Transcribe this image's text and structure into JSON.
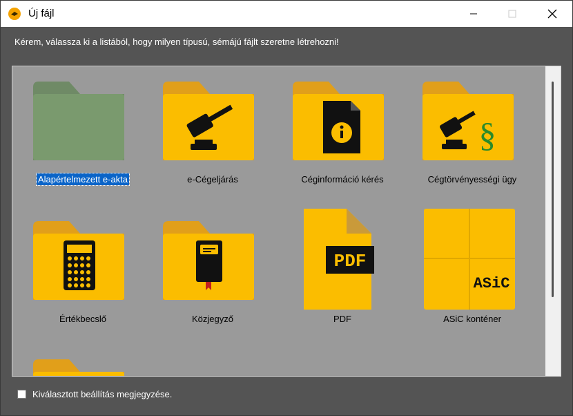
{
  "window": {
    "title": "Új fájl"
  },
  "instruction": "Kérem, válassza ki a listából, hogy milyen típusú, sémájú fájlt szeretne létrehozni!",
  "items": [
    {
      "label": "Alapértelmezett e-akta",
      "icon": "default-folder-icon",
      "selected": true
    },
    {
      "label": "e-Cégeljárás",
      "icon": "gavel-folder-icon"
    },
    {
      "label": "Céginformáció kérés",
      "icon": "info-document-folder-icon"
    },
    {
      "label": "Cégtörvényességi ügy",
      "icon": "gavel-paragraph-folder-icon"
    },
    {
      "label": "Értékbecslő",
      "icon": "calculator-folder-icon"
    },
    {
      "label": "Közjegyző",
      "icon": "notebook-folder-icon"
    },
    {
      "label": "PDF",
      "icon": "pdf-file-icon",
      "badge": "PDF"
    },
    {
      "label": "ASiC konténer",
      "icon": "asic-container-icon",
      "badge": "ASiC"
    }
  ],
  "remember_setting": {
    "label": "Kiválasztott beállítás megjegyzése.",
    "checked": false
  },
  "colors": {
    "folder": "#fbbd00",
    "folder_tab": "#e19f1a",
    "default_folder": "#7a9a6e",
    "selection": "#0a64c8"
  }
}
